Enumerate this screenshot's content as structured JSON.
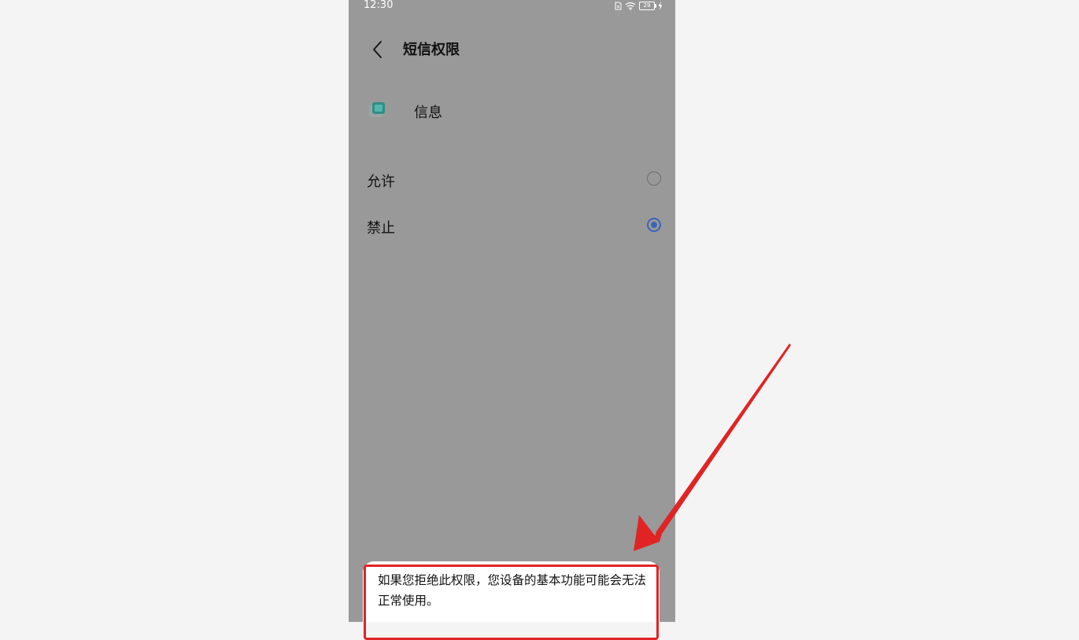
{
  "status_bar": {
    "time": "12:30",
    "battery": "29",
    "icons": [
      "sim-icon",
      "wifi-icon",
      "battery-icon",
      "charging-icon"
    ]
  },
  "header": {
    "back_icon": "chevron-left-icon",
    "title": "短信权限"
  },
  "app": {
    "icon": "messages-app-icon",
    "name": "信息"
  },
  "options": [
    {
      "label": "允许",
      "selected": false
    },
    {
      "label": "禁止",
      "selected": true
    }
  ],
  "dialog": {
    "message": "如果您拒绝此权限，您设备的基本功能可能会无法正常使用。"
  },
  "annotation": {
    "color": "#e02424"
  },
  "colors": {
    "overlay": "#999999",
    "accent": "#3d64b8",
    "page_background": "#f4f4f4"
  }
}
